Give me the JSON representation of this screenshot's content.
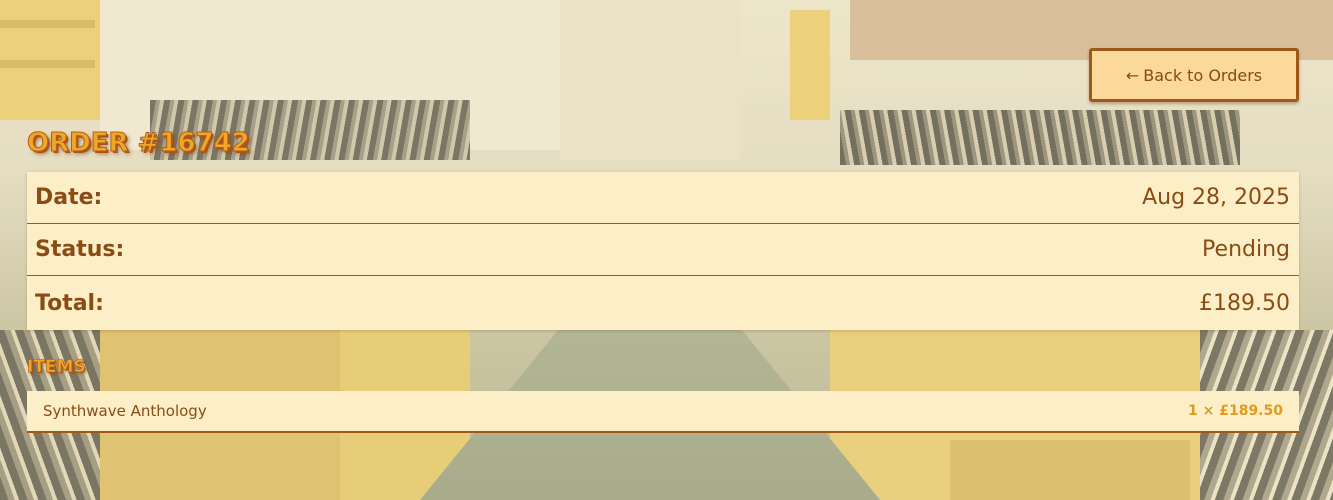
{
  "header": {
    "back_button_arrow": "←",
    "back_button_label": "Back to Orders"
  },
  "order": {
    "title": "Order #16742",
    "date_label": "Date:",
    "date_value": "Aug 28, 2025",
    "status_label": "Status:",
    "status_value": "Pending",
    "total_label": "Total:",
    "total_value": "£189.50"
  },
  "items": {
    "title": "Items",
    "rows": [
      {
        "name": "Synthwave Anthology",
        "qty_price": "1 × £189.50"
      }
    ]
  },
  "colors": {
    "accent": "#f3a626",
    "text_brown": "#8a4c14",
    "panel_cream": "#fcefc8",
    "border_brown": "#a0571a",
    "button_fill": "#fad99a"
  },
  "icons": {
    "back": "arrow-left-icon"
  }
}
